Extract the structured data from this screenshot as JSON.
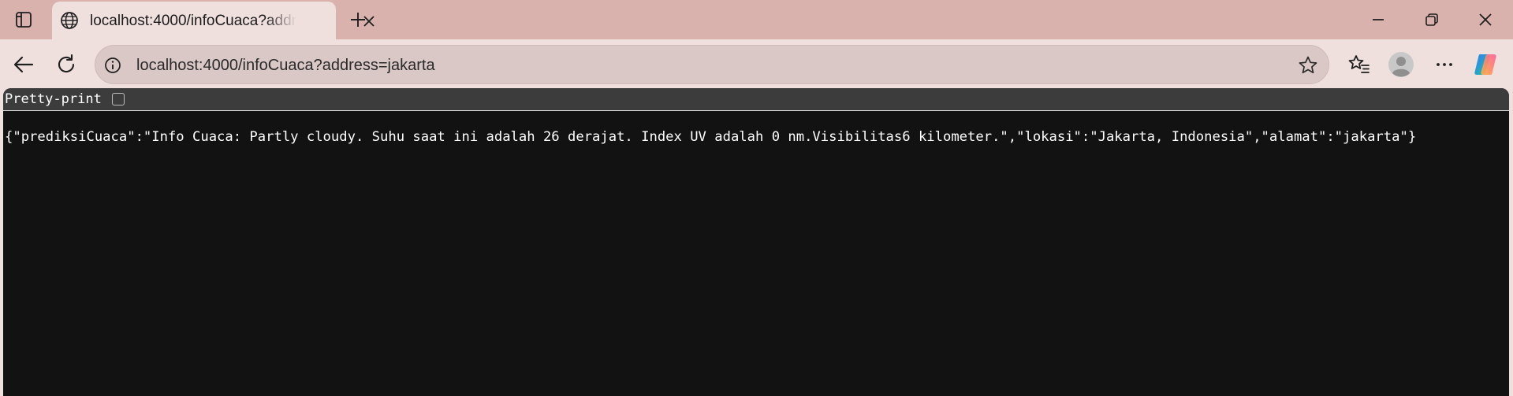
{
  "browser": {
    "tab": {
      "title": "localhost:4000/infoCuaca?address=jakarta"
    },
    "address_bar": {
      "url": "localhost:4000/infoCuaca?address=jakarta"
    },
    "icons": {
      "tab_actions": "tab-actions-icon",
      "favicon": "globe-icon",
      "tab_close": "close-icon",
      "new_tab": "plus-icon",
      "minimize": "minimize-icon",
      "restore": "restore-icon",
      "close_window": "close-icon",
      "back": "back-arrow-icon",
      "refresh": "refresh-icon",
      "site_info": "info-icon",
      "favorite": "star-icon",
      "favorites": "favorites-icon",
      "profile": "profile-avatar-icon",
      "menu": "more-icon",
      "copilot": "copilot-icon"
    },
    "colors": {
      "frame": "#d9b2ad",
      "toolbar": "#efe0de",
      "content_bg": "#121212",
      "pretty_print_bar": "#3c3c3c"
    }
  },
  "viewer": {
    "pretty_print_label": "Pretty-print",
    "pretty_print_checked": false,
    "json_text": "{\"prediksiCuaca\":\"Info Cuaca: Partly cloudy. Suhu saat ini adalah 26 derajat. Index UV adalah 0 nm.Visibilitas6 kilometer.\",\"lokasi\":\"Jakarta, Indonesia\",\"alamat\":\"jakarta\"}"
  }
}
